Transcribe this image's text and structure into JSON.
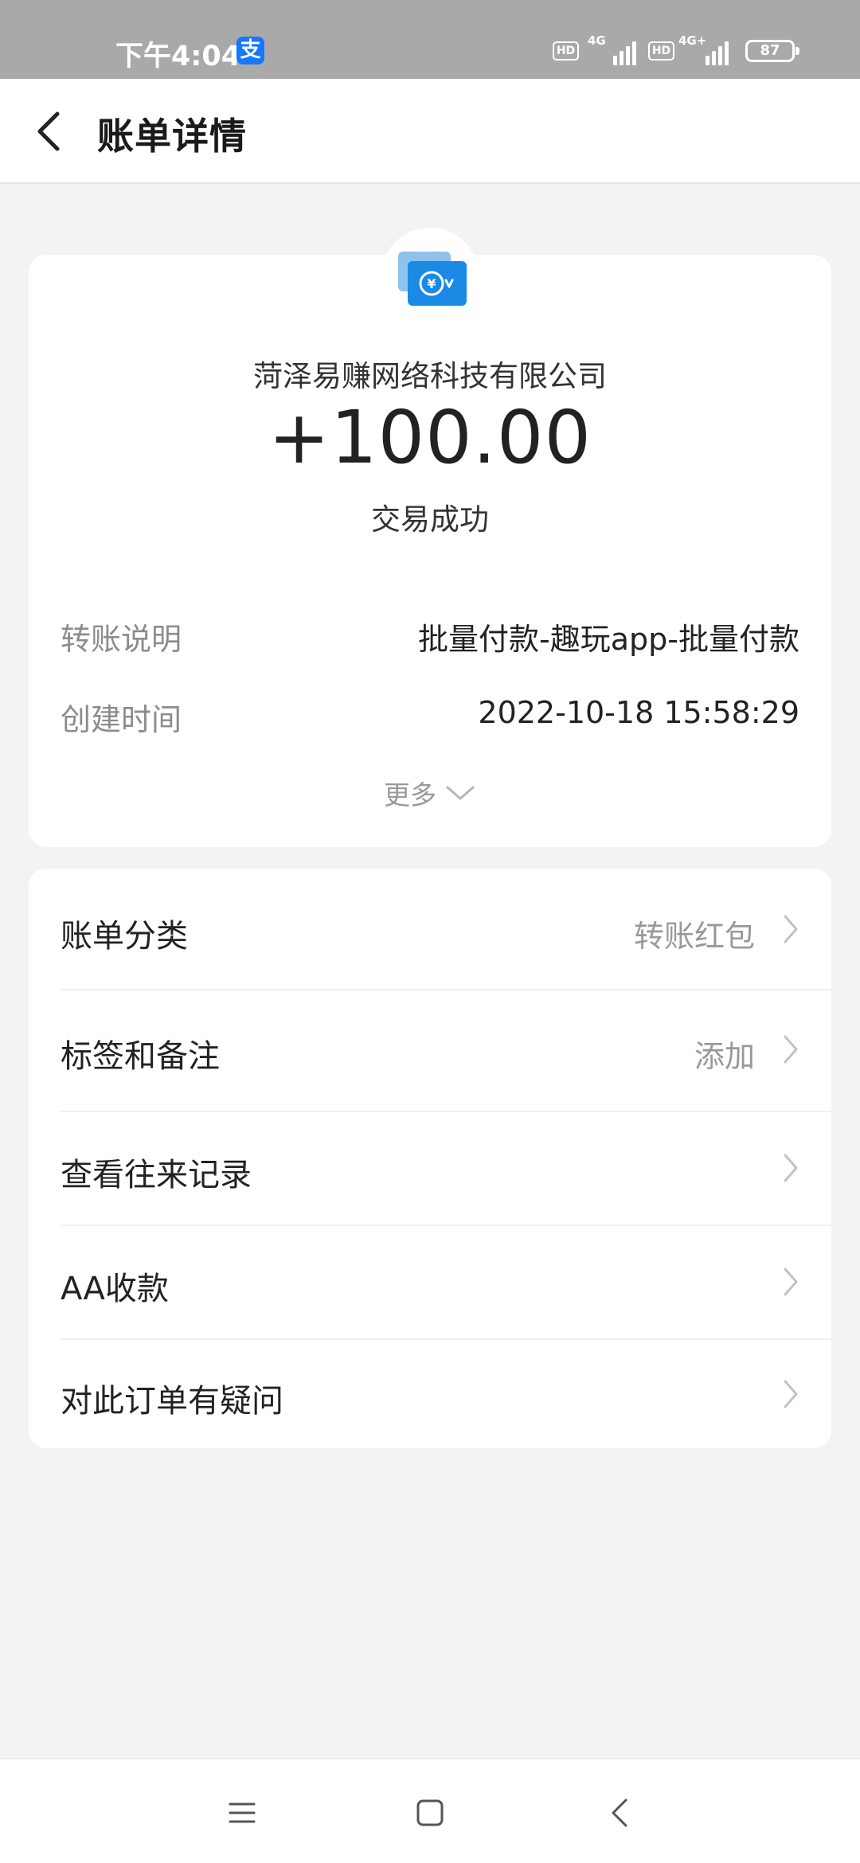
{
  "status_bar": {
    "time": "下午4:04",
    "app_icon": "支",
    "hd1": "HD",
    "net1": "4G",
    "hd2": "HD",
    "net2": "4G+",
    "battery": "87"
  },
  "header": {
    "back_icon": "chevron-left-icon",
    "title": "账单详情"
  },
  "summary": {
    "payer": "菏泽易赚网络科技有限公司",
    "amount": "+100.00",
    "status": "交易成功",
    "details": [
      {
        "label": "转账说明",
        "value": "批量付款-趣玩app-批量付款"
      },
      {
        "label": "创建时间",
        "value": "2022-10-18 15:58:29"
      }
    ],
    "more_label": "更多"
  },
  "actions": [
    {
      "label": "账单分类",
      "value": "转账红包"
    },
    {
      "label": "标签和备注",
      "value": "添加"
    },
    {
      "label": "查看往来记录",
      "value": ""
    },
    {
      "label": "AA收款",
      "value": ""
    },
    {
      "label": "对此订单有疑问",
      "value": ""
    }
  ],
  "nav": {
    "icons": [
      "menu-icon",
      "home-icon",
      "back-icon"
    ]
  },
  "colors": {
    "accent_blue": "#1677ff",
    "status_bar": "#a9a9a9",
    "background": "#f3f3f5"
  }
}
